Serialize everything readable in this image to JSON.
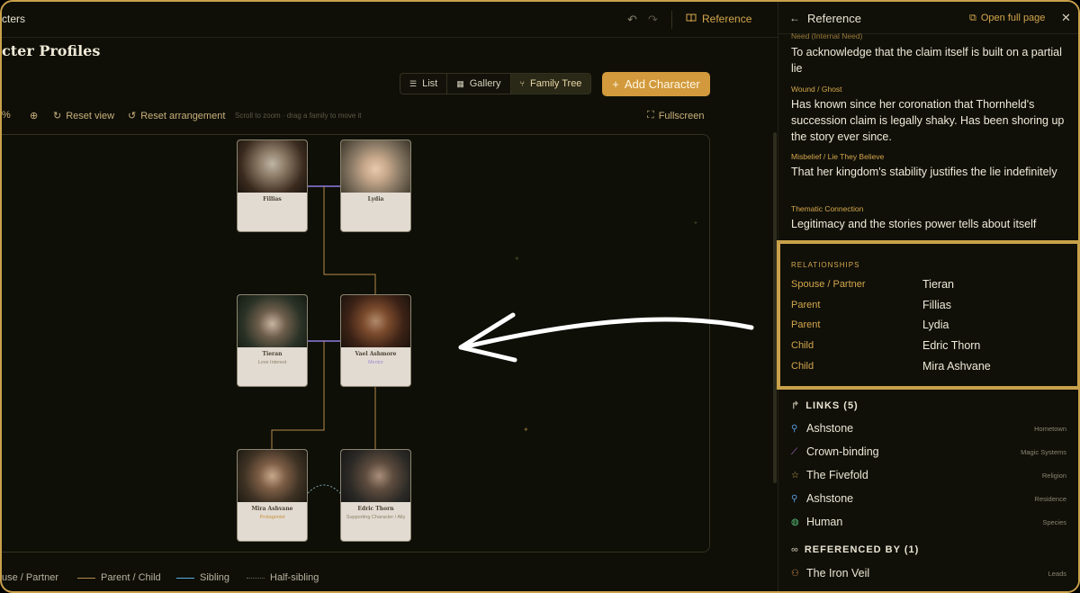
{
  "topbar": {
    "crumb": "cters",
    "undo_icon": "undo-icon",
    "redo_icon": "redo-icon",
    "reference_label": "Reference"
  },
  "page": {
    "title": "cter Profiles"
  },
  "views": {
    "list": "List",
    "gallery": "Gallery",
    "family_tree": "Family Tree",
    "active": "Family Tree"
  },
  "add_character": "Add Character",
  "toolbar": {
    "zoom_percent": "%",
    "reset_view": "Reset view",
    "reset_arrangement": "Reset arrangement",
    "hint": "Scroll to zoom · drag a family to move it",
    "fullscreen": "Fullscreen"
  },
  "tree": {
    "cards": [
      {
        "name": "Fillias",
        "role": ""
      },
      {
        "name": "Lydia",
        "role": ""
      },
      {
        "name": "Tieran",
        "role": "Love Interest"
      },
      {
        "name": "Vael Ashmore",
        "role": "Mentor"
      },
      {
        "name": "Mira Ashvane",
        "role": "Protagonist"
      },
      {
        "name": "Edric Thorn",
        "role": "Supporting Character / Ally"
      }
    ]
  },
  "legend": {
    "spouse": "use / Partner",
    "parent_child": "Parent / Child",
    "sibling": "Sibling",
    "half_sibling": "Half-sibling"
  },
  "panel": {
    "title": "Reference",
    "open_full": "Open full page",
    "fields": [
      {
        "label": "Need (Internal Need)",
        "value": "To acknowledge that the claim itself is built on a partial lie"
      },
      {
        "label": "Wound / Ghost",
        "value": "Has known since her coronation that Thornheld's succession claim is legally shaky. Has been shoring up the story ever since."
      },
      {
        "label": "Misbelief / Lie They Believe",
        "value": "That her kingdom's stability justifies the lie indefinitely"
      },
      {
        "label": "Thematic Connection",
        "value": "Legitimacy and the stories power tells about itself"
      }
    ],
    "relationships_head": "RELATIONSHIPS",
    "relationships": [
      {
        "type": "Spouse / Partner",
        "name": "Tieran"
      },
      {
        "type": "Parent",
        "name": "Fillias"
      },
      {
        "type": "Parent",
        "name": "Lydia"
      },
      {
        "type": "Child",
        "name": "Edric Thorn"
      },
      {
        "type": "Child",
        "name": "Mira Ashvane"
      }
    ],
    "links_head": "LINKS (5)",
    "links": [
      {
        "name": "Ashstone",
        "type": "Hometown",
        "icon": "pin-icon"
      },
      {
        "name": "Crown-binding",
        "type": "Magic Systems",
        "icon": "wand-icon"
      },
      {
        "name": "The Fivefold",
        "type": "Religion",
        "icon": "star-icon"
      },
      {
        "name": "Ashstone",
        "type": "Residence",
        "icon": "pin-icon"
      },
      {
        "name": "Human",
        "type": "Species",
        "icon": "globe-icon"
      }
    ],
    "referenced_head": "REFERENCED BY (1)",
    "referenced": [
      {
        "name": "The Iron Veil",
        "type": "Leads",
        "icon": "people-icon"
      }
    ]
  },
  "colors": {
    "accent": "#d4a64b",
    "spouse_line": "#8f7be0",
    "parent_line": "#b58a4a",
    "sibling_line": "#5ab0e0",
    "highlight_border": "#c9a14a"
  }
}
